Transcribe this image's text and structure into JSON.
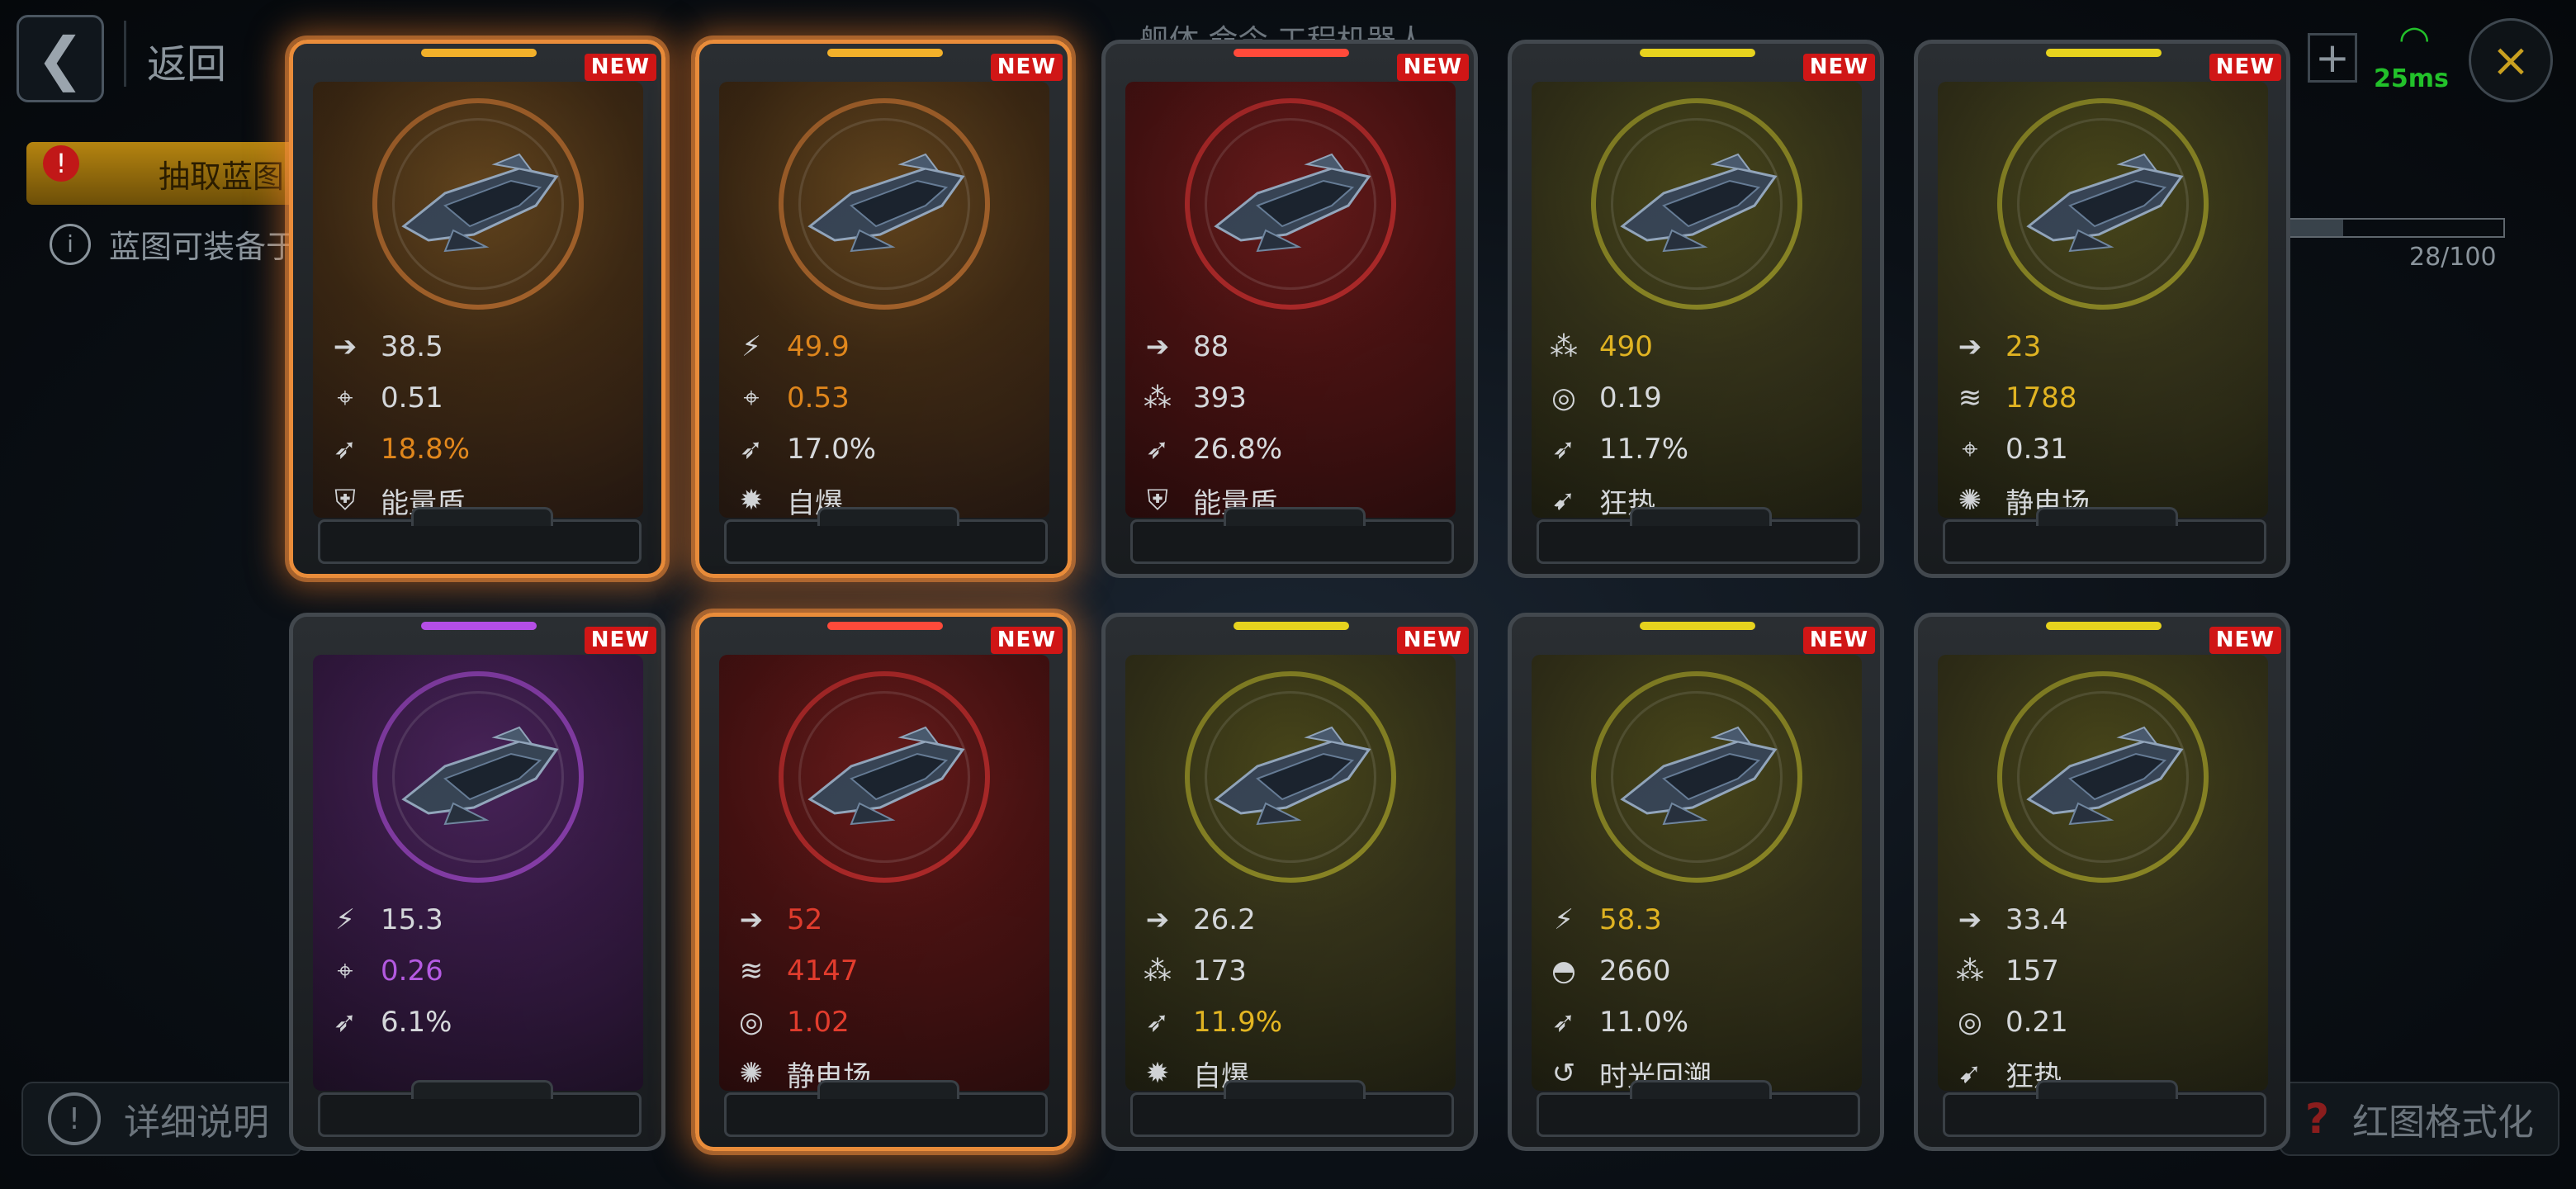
{
  "header": {
    "back_label": "返回",
    "top_tabs": "舰体      命令      工程机器人",
    "ping": "25ms",
    "plus_label": "+"
  },
  "sidebar": {
    "active_tab_label": "抽取蓝图",
    "info_text": "蓝图可装备于"
  },
  "progress": {
    "text": "28/100",
    "value": 0.28
  },
  "footer": {
    "detail_label": "详细说明",
    "format_label": "红图格式化"
  },
  "cards": [
    {
      "new": "NEW",
      "theme": "orange",
      "bar": "#f2b02a",
      "glow": true,
      "stats": [
        {
          "icon": "speed-icon",
          "value": "38.5",
          "color": "#e3e6e9"
        },
        {
          "icon": "crosshair-icon",
          "value": "0.51",
          "color": "#e3e6e9"
        },
        {
          "icon": "missile-icon",
          "value": "18.8%",
          "color": "#ee8f1e"
        },
        {
          "icon": "shield-icon",
          "value": "能量盾",
          "color": "#e3e6e9"
        }
      ]
    },
    {
      "new": "NEW",
      "theme": "orange",
      "bar": "#f2b02a",
      "glow": true,
      "stats": [
        {
          "icon": "thrust-icon",
          "value": "49.9",
          "color": "#ee8f1e"
        },
        {
          "icon": "crosshair-icon",
          "value": "0.53",
          "color": "#ee8f1e"
        },
        {
          "icon": "missile-icon",
          "value": "17.0%",
          "color": "#e3e6e9"
        },
        {
          "icon": "explode-icon",
          "value": "自爆",
          "color": "#e3e6e9"
        }
      ]
    },
    {
      "new": "NEW",
      "theme": "red",
      "bar": "#ff4a3a",
      "glow": false,
      "stats": [
        {
          "icon": "speed-icon",
          "value": "88",
          "color": "#e3e6e9"
        },
        {
          "icon": "cluster-icon",
          "value": "393",
          "color": "#e3e6e9"
        },
        {
          "icon": "missile-icon",
          "value": "26.8%",
          "color": "#e3e6e9"
        },
        {
          "icon": "shield-icon",
          "value": "能量盾",
          "color": "#e3e6e9"
        }
      ]
    },
    {
      "new": "NEW",
      "theme": "yellow",
      "bar": "#e6d21e",
      "glow": false,
      "stats": [
        {
          "icon": "cluster-icon",
          "value": "490",
          "color": "#f0c024"
        },
        {
          "icon": "target-ring-icon",
          "value": "0.19",
          "color": "#e3e6e9"
        },
        {
          "icon": "missile-icon",
          "value": "11.7%",
          "color": "#e3e6e9"
        },
        {
          "icon": "frenzy-icon",
          "value": "狂热",
          "color": "#e3e6e9"
        }
      ]
    },
    {
      "new": "NEW",
      "theme": "yellow",
      "bar": "#e6d21e",
      "glow": false,
      "stats": [
        {
          "icon": "speed-icon",
          "value": "23",
          "color": "#f0c024"
        },
        {
          "icon": "armor-icon",
          "value": "1788",
          "color": "#f0c024"
        },
        {
          "icon": "crosshair-icon",
          "value": "0.31",
          "color": "#e3e6e9"
        },
        {
          "icon": "static-icon",
          "value": "静电场",
          "color": "#e3e6e9"
        }
      ]
    },
    {
      "new": "NEW",
      "theme": "purple",
      "bar": "#b44ee6",
      "glow": false,
      "stats": [
        {
          "icon": "thrust-icon",
          "value": "15.3",
          "color": "#e3e6e9"
        },
        {
          "icon": "crosshair-icon",
          "value": "0.26",
          "color": "#c060f0"
        },
        {
          "icon": "missile-icon",
          "value": "6.1%",
          "color": "#e3e6e9"
        }
      ]
    },
    {
      "new": "NEW",
      "theme": "red",
      "bar": "#ff4a3a",
      "glow": true,
      "stats": [
        {
          "icon": "speed-icon",
          "value": "52",
          "color": "#f04030"
        },
        {
          "icon": "armor-icon",
          "value": "4147",
          "color": "#f04030"
        },
        {
          "icon": "target-ring-icon",
          "value": "1.02",
          "color": "#f04030"
        },
        {
          "icon": "static-icon",
          "value": "静电场",
          "color": "#e3e6e9"
        }
      ]
    },
    {
      "new": "NEW",
      "theme": "yellow",
      "bar": "#e6d21e",
      "glow": false,
      "stats": [
        {
          "icon": "speed-icon",
          "value": "26.2",
          "color": "#e3e6e9"
        },
        {
          "icon": "cluster-icon",
          "value": "173",
          "color": "#e3e6e9"
        },
        {
          "icon": "missile-icon",
          "value": "11.9%",
          "color": "#f0c024"
        },
        {
          "icon": "explode-icon",
          "value": "自爆",
          "color": "#e3e6e9"
        }
      ]
    },
    {
      "new": "NEW",
      "theme": "yellow",
      "bar": "#e6d21e",
      "glow": false,
      "stats": [
        {
          "icon": "thrust-icon",
          "value": "58.3",
          "color": "#f0c024"
        },
        {
          "icon": "dome-icon",
          "value": "2660",
          "color": "#e3e6e9"
        },
        {
          "icon": "missile-icon",
          "value": "11.0%",
          "color": "#e3e6e9"
        },
        {
          "icon": "rewind-icon",
          "value": "时光回溯",
          "color": "#e3e6e9"
        }
      ]
    },
    {
      "new": "NEW",
      "theme": "yellow",
      "bar": "#e6d21e",
      "glow": false,
      "stats": [
        {
          "icon": "speed-icon",
          "value": "33.4",
          "color": "#e3e6e9"
        },
        {
          "icon": "cluster-icon",
          "value": "157",
          "color": "#e3e6e9"
        },
        {
          "icon": "target-ring-icon",
          "value": "0.21",
          "color": "#e3e6e9"
        },
        {
          "icon": "frenzy-icon",
          "value": "狂热",
          "color": "#e3e6e9"
        }
      ]
    }
  ]
}
